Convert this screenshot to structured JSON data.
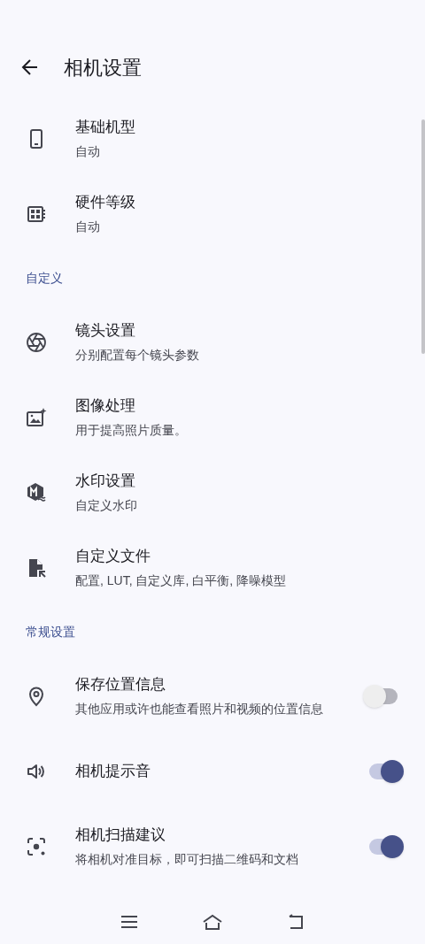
{
  "header": {
    "title": "相机设置"
  },
  "sections": [
    {
      "items": [
        {
          "title": "基础机型",
          "subtitle": "自动"
        },
        {
          "title": "硬件等级",
          "subtitle": "自动"
        }
      ]
    },
    {
      "label": "自定义",
      "items": [
        {
          "title": "镜头设置",
          "subtitle": "分别配置每个镜头参数"
        },
        {
          "title": "图像处理",
          "subtitle": "用于提高照片质量。"
        },
        {
          "title": "水印设置",
          "subtitle": "自定义水印"
        },
        {
          "title": "自定义文件",
          "subtitle": "配置, LUT, 自定义库, 白平衡, 降噪模型"
        }
      ]
    },
    {
      "label": "常规设置",
      "items": [
        {
          "title": "保存位置信息",
          "subtitle": "其他应用或许也能查看照片和视频的位置信息",
          "toggle": {
            "on": false
          }
        },
        {
          "title": "相机提示音",
          "toggle": {
            "on": true
          }
        },
        {
          "title": "相机扫描建议",
          "subtitle": "将相机对准目标，即可扫描二维码和文档",
          "toggle": {
            "on": true
          }
        }
      ]
    }
  ]
}
